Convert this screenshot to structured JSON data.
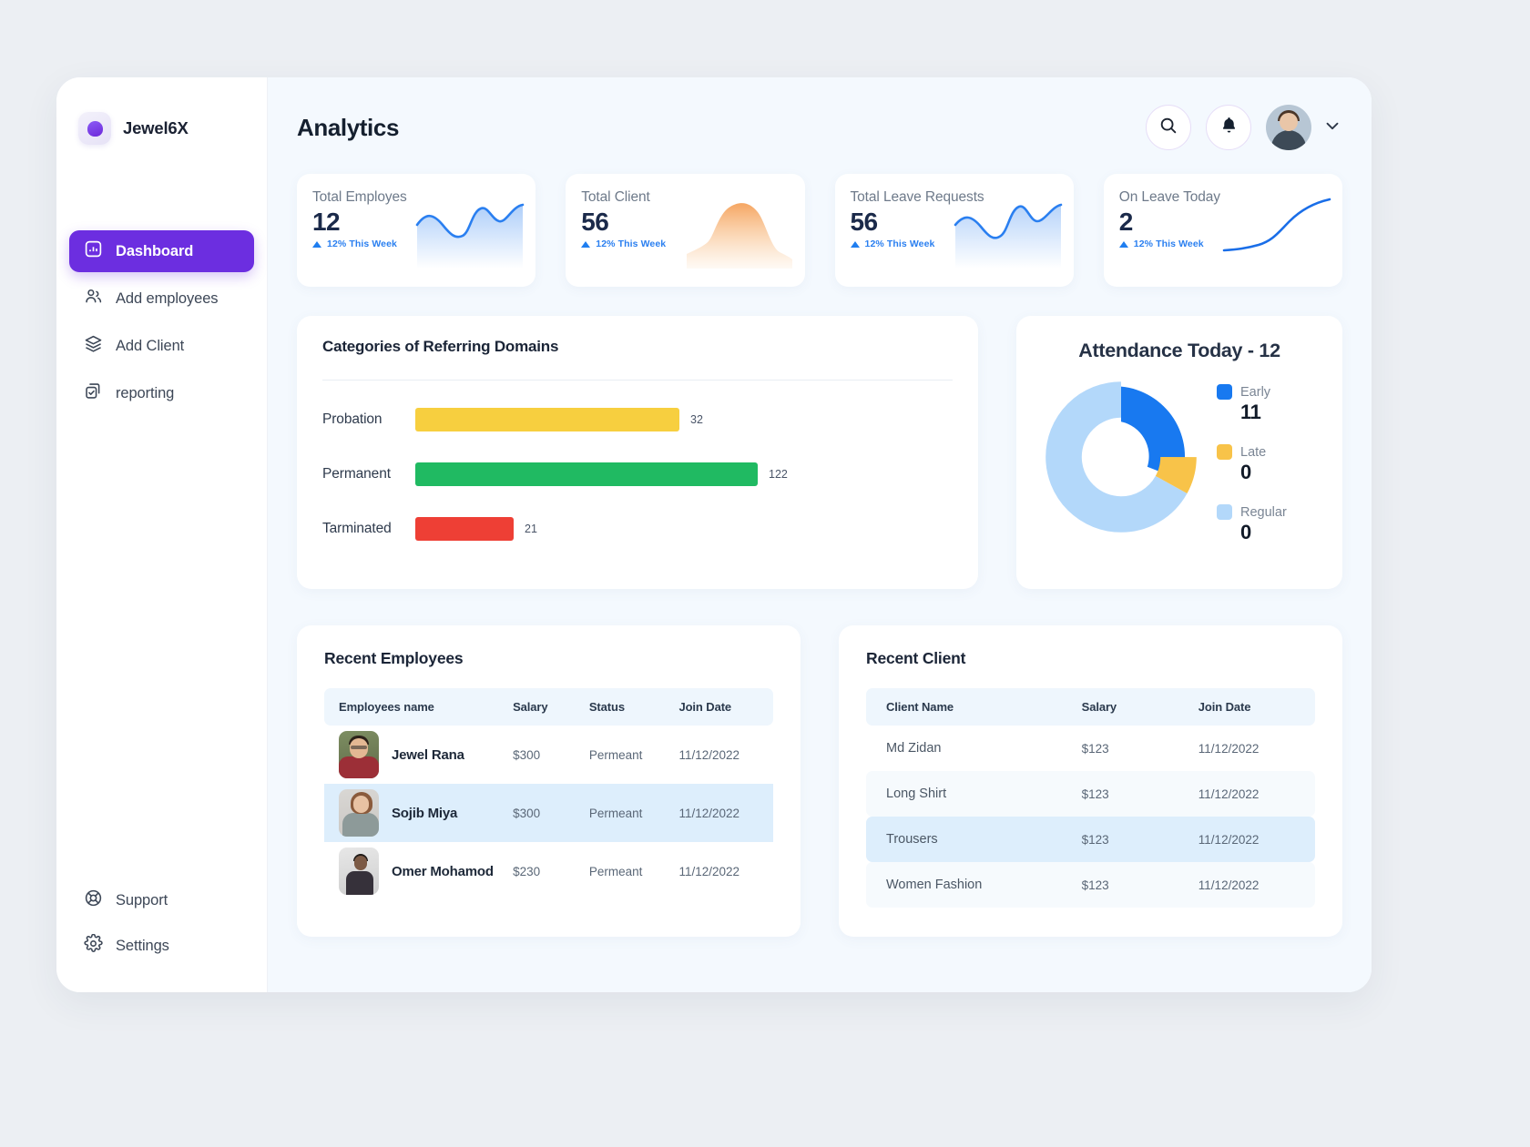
{
  "brand": {
    "name": "Jewel6X",
    "logo_icon": "droplet-logo-icon"
  },
  "sidebar": {
    "items": [
      {
        "label": "Dashboard",
        "icon": "bar-chart-icon",
        "active": true
      },
      {
        "label": "Add employees",
        "icon": "users-icon",
        "active": false
      },
      {
        "label": "Add Client",
        "icon": "layers-icon",
        "active": false
      },
      {
        "label": "reporting",
        "icon": "copy-check-icon",
        "active": false
      }
    ],
    "bottom_items": [
      {
        "label": "Support",
        "icon": "lifebuoy-icon"
      },
      {
        "label": "Settings",
        "icon": "gear-icon"
      }
    ]
  },
  "header": {
    "title": "Analytics",
    "search_icon": "search-icon",
    "notification_icon": "bell-icon",
    "avatar_icon": "user-avatar",
    "chevron_icon": "chevron-down-icon"
  },
  "stats": [
    {
      "label": "Total Employes",
      "value": "12",
      "trend": "12% This Week",
      "color": "#2a7ff0"
    },
    {
      "label": "Total Client",
      "value": "56",
      "trend": "12% This Week",
      "color": "#f5a15a"
    },
    {
      "label": "Total Leave Requests",
      "value": "56",
      "trend": "12% This Week",
      "color": "#2a7ff0"
    },
    {
      "label": "On Leave Today",
      "value": "2",
      "trend": "12% This Week",
      "color": "#2a7ff0"
    }
  ],
  "chart_data": [
    {
      "type": "bar",
      "title": "Categories of Referring Domains",
      "orientation": "horizontal",
      "categories": [
        "Probation",
        "Permanent",
        "Tarminated"
      ],
      "values": [
        32,
        122,
        21
      ],
      "colors": [
        "#f7cf3f",
        "#20ba62",
        "#ee3f35"
      ],
      "xlabel": "",
      "ylabel": "",
      "xlim": [
        0,
        160
      ],
      "grid": false,
      "legend": "none",
      "data_labels": [
        "32",
        "122",
        "21"
      ]
    },
    {
      "type": "pie",
      "subtype": "donut",
      "title": "Attendance Today - 12",
      "total": 12,
      "categories": [
        "Early",
        "Late",
        "Regular"
      ],
      "values": [
        11,
        0,
        0
      ],
      "slice_fractions": [
        0.25,
        0.08,
        0.67
      ],
      "colors": [
        "#1879f0",
        "#f8c349",
        "#b3d8fa"
      ],
      "legend": "right"
    }
  ],
  "bars_card": {
    "title": "Categories of Referring Domains"
  },
  "donut_card": {
    "title": "Attendance Today - 12"
  },
  "employees_table": {
    "title": "Recent Employees",
    "columns": [
      "Employees name",
      "Salary",
      "Status",
      "Join Date"
    ],
    "rows": [
      {
        "name": "Jewel Rana",
        "salary": "$300",
        "status": "Permeant",
        "join_date": "11/12/2022",
        "highlighted": false
      },
      {
        "name": "Sojib Miya",
        "salary": "$300",
        "status": "Permeant",
        "join_date": "11/12/2022",
        "highlighted": true
      },
      {
        "name": "Omer Mohamod",
        "salary": "$230",
        "status": "Permeant",
        "join_date": "11/12/2022",
        "highlighted": false
      }
    ]
  },
  "clients_table": {
    "title": "Recent Client",
    "columns": [
      "Client Name",
      "Salary",
      "Join Date"
    ],
    "rows": [
      {
        "name": "Md Zidan",
        "salary": "$123",
        "join_date": "11/12/2022",
        "style": "plain"
      },
      {
        "name": "Long Shirt",
        "salary": "$123",
        "join_date": "11/12/2022",
        "style": "alt"
      },
      {
        "name": "Trousers",
        "salary": "$123",
        "join_date": "11/12/2022",
        "style": "hl"
      },
      {
        "name": "Women Fashion",
        "salary": "$123",
        "join_date": "11/12/2022",
        "style": "alt"
      }
    ]
  },
  "colors": {
    "brand_purple": "#6c2ee0",
    "accent_blue": "#2a7ff0",
    "bar_yellow": "#f7cf3f",
    "bar_green": "#20ba62",
    "bar_red": "#ee3f35",
    "donut_early": "#1879f0",
    "donut_late": "#f8c349",
    "donut_regular": "#b3d8fa"
  }
}
